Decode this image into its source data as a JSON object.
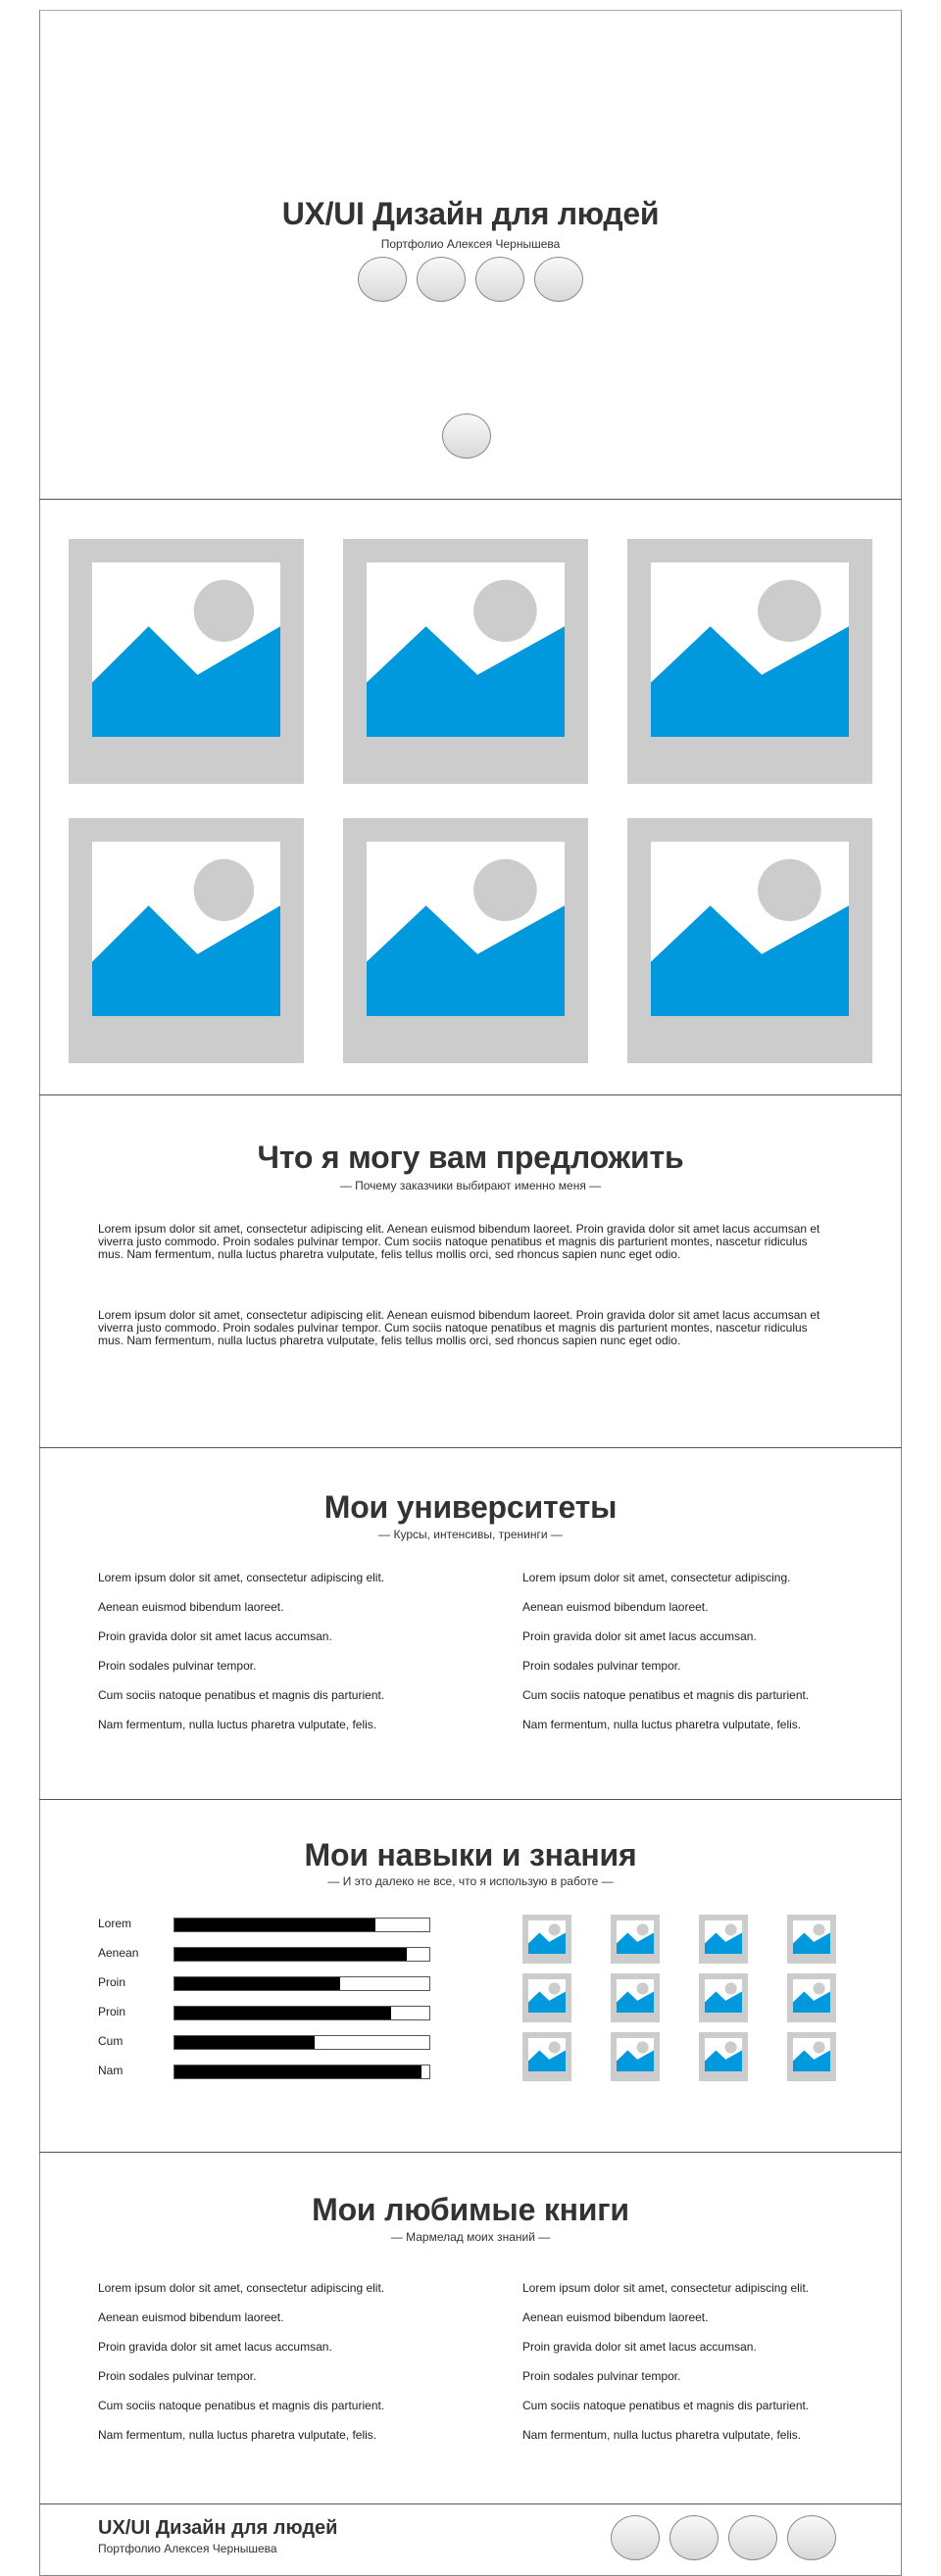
{
  "hero": {
    "title": "UX/UI Дизайн для людей",
    "subtitle": "Портфолио Алексея Чернышева"
  },
  "offer": {
    "title": "Что я могу вам предложить",
    "subtitle": "— Почему заказчики выбирают именно меня —",
    "paragraphs": [
      "Lorem ipsum dolor sit amet, consectetur adipiscing elit. Aenean euismod bibendum laoreet. Proin gravida dolor sit amet lacus accumsan et viverra justo commodo. Proin sodales pulvinar tempor. Cum sociis natoque penatibus et magnis dis parturient montes, nascetur ridiculus mus. Nam fermentum, nulla luctus pharetra vulputate, felis tellus mollis orci, sed rhoncus sapien nunc eget odio.",
      "Lorem ipsum dolor sit amet, consectetur adipiscing elit. Aenean euismod bibendum laoreet. Proin gravida dolor sit amet lacus accumsan et viverra justo commodo. Proin sodales pulvinar tempor. Cum sociis natoque penatibus et magnis dis parturient montes, nascetur ridiculus mus. Nam fermentum, nulla luctus pharetra vulputate, felis tellus mollis orci, sed rhoncus sapien nunc eget odio."
    ]
  },
  "universities": {
    "title": "Мои университеты",
    "subtitle": "— Курсы, интенсивы, тренинги —",
    "left": [
      "Lorem ipsum dolor sit amet, consectetur adipiscing elit.",
      "Aenean euismod bibendum laoreet.",
      "Proin gravida dolor sit amet lacus accumsan.",
      "Proin sodales pulvinar tempor.",
      "Cum sociis natoque penatibus et magnis dis parturient.",
      "Nam fermentum, nulla luctus pharetra vulputate, felis."
    ],
    "right": [
      "Lorem ipsum dolor sit amet, consectetur adipiscing.",
      "Aenean euismod bibendum laoreet.",
      "Proin gravida dolor sit amet lacus accumsan.",
      "Proin sodales pulvinar tempor.",
      "Cum sociis natoque penatibus et magnis dis parturient.",
      "Nam fermentum, nulla luctus pharetra vulputate, felis."
    ]
  },
  "skills": {
    "title": "Мои навыки и знания",
    "subtitle": "— И это далеко не все, что я использую в работе —",
    "items": [
      {
        "label": "Lorem",
        "level": 0.79
      },
      {
        "label": "Aenean",
        "level": 0.91
      },
      {
        "label": "Proin",
        "level": 0.65
      },
      {
        "label": "Proin",
        "level": 0.85
      },
      {
        "label": "Cum",
        "level": 0.55
      },
      {
        "label": "Nam",
        "level": 0.97
      }
    ]
  },
  "books": {
    "title": "Мои любимые книги",
    "subtitle": "— Мармелад моих знаний —",
    "left": [
      "Lorem ipsum dolor sit amet, consectetur adipiscing elit.",
      "Aenean euismod bibendum laoreet.",
      "Proin gravida dolor sit amet lacus accumsan.",
      "Proin sodales pulvinar tempor.",
      "Cum sociis natoque penatibus et magnis dis parturient.",
      "Nam fermentum, nulla luctus pharetra vulputate, felis."
    ],
    "right": [
      "Lorem ipsum dolor sit amet, consectetur adipiscing elit.",
      "Aenean euismod bibendum laoreet.",
      "Proin gravida dolor sit amet lacus accumsan.",
      "Proin sodales pulvinar tempor.",
      "Cum sociis natoque penatibus et magnis dis parturient.",
      "Nam fermentum, nulla luctus pharetra vulputate, felis."
    ]
  },
  "footer": {
    "title": "UX/UI Дизайн для людей",
    "subtitle": "Портфолио Алексея Чернышева"
  },
  "colors": {
    "accent": "#0099dd",
    "placeholder_gray": "#cccccc",
    "bar": "#000000"
  },
  "icons": {
    "image_placeholder": "image-placeholder-icon",
    "circle_button": "social-circle-button"
  }
}
